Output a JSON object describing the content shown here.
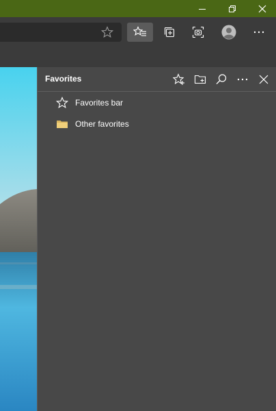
{
  "window": {
    "minimize_icon": "minimize-icon",
    "restore_icon": "restore-icon",
    "close_icon": "close-icon",
    "titlebar_color": "#4a6715"
  },
  "toolbar": {
    "address_star_icon": "star-outline-icon",
    "buttons": [
      "favorites-icon",
      "collections-icon",
      "screenshot-icon",
      "profile-icon",
      "more-icon"
    ]
  },
  "favorites_panel": {
    "title": "Favorites",
    "header_icons": [
      "add-favorite-icon",
      "add-folder-icon",
      "search-icon",
      "more-icon",
      "close-icon"
    ],
    "items": [
      {
        "label": "Favorites bar",
        "icon": "star-outline-icon"
      },
      {
        "label": "Other favorites",
        "icon": "folder-icon"
      }
    ]
  }
}
